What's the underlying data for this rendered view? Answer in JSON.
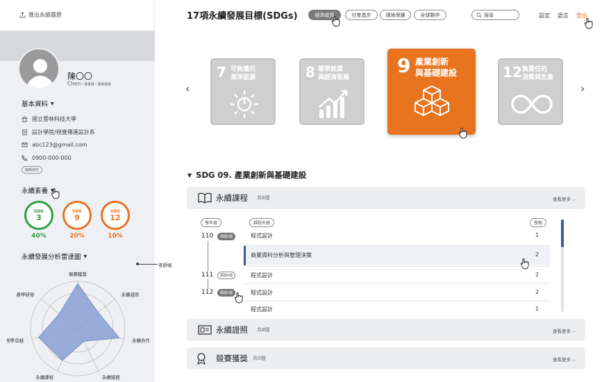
{
  "sidebar": {
    "export_label": "匯出永續履歷",
    "name": "陳〇〇",
    "username": "Chen-aaa-aaaa",
    "basic_title": "基本資料",
    "school": "國立雲林科技大學",
    "department": "設計學院/視覺傳達設計系",
    "email": "abc123@gmail.com",
    "phone": "0900-000-000",
    "edit_label": "編輯資料",
    "literacy_title": "永續素養",
    "rings": [
      {
        "label": "SDG",
        "num": "3",
        "pct": "40%",
        "color": "#2f9e44",
        "level": 0.4
      },
      {
        "label": "SDG",
        "num": "9",
        "pct": "20%",
        "color": "#e8741f",
        "level": 0.2
      },
      {
        "label": "SDG",
        "num": "12",
        "pct": "10%",
        "color": "#e8741f",
        "level": 0.1
      }
    ],
    "radar_title": "永續發展分析雷達圖",
    "teacher_note": "老師端"
  },
  "chart_data": {
    "type": "radar",
    "axes": [
      "競賽獲獎",
      "永續證照",
      "永續合作",
      "永續服務",
      "永續課程",
      "教學卓越",
      "產學研發"
    ],
    "values": [
      0.95,
      0.55,
      0.9,
      0.3,
      0.75,
      0.85,
      0.5
    ],
    "range": [
      0,
      1
    ],
    "grid": true
  },
  "header": {
    "title": "17項永續發展目標(SDGs)",
    "pills": [
      "經濟成長",
      "社會進步",
      "環境保護",
      "全球夥伴"
    ],
    "active_pill": 0,
    "search_placeholder": "搜尋",
    "links": [
      "設定",
      "語言",
      "登出"
    ],
    "logout_color": "#e8741f"
  },
  "carousel": {
    "cards": [
      {
        "num": "7",
        "title1": "可負擔的",
        "title2": "潔淨能源",
        "icon": "sun-power-icon"
      },
      {
        "num": "8",
        "title1": "尊榮就業",
        "title2": "與經濟發展",
        "icon": "growth-chart-icon"
      },
      {
        "num": "9",
        "title1": "產業創新",
        "title2": "與基礎建設",
        "icon": "cubes-icon"
      },
      {
        "num": "12",
        "title1": "負責任的",
        "title2": "消費與生產",
        "icon": "infinity-icon"
      }
    ],
    "prev": "‹",
    "next": "›"
  },
  "section": {
    "heading": "SDG 09. 產業創新與基礎建設",
    "courses": {
      "label": "永續課程",
      "count": "共8個",
      "more": "查看更多",
      "col_year": "學年度",
      "col_name": "課程名稱",
      "col_period": "學期",
      "years": [
        {
          "year": "110",
          "tag": "展開2個"
        },
        {
          "year": "111",
          "tag": "展開4個"
        },
        {
          "year": "112",
          "tag": "展開2個"
        }
      ],
      "rows": [
        {
          "name": "程式設計",
          "period": "1"
        },
        {
          "name": "商業資料分析與管理決策",
          "period": "2"
        },
        {
          "name": "程式設計",
          "period": "2"
        },
        {
          "name": "程式設計",
          "period": "2"
        },
        {
          "name": "程式設計",
          "period": "1"
        }
      ]
    },
    "certs": {
      "label": "永續證照",
      "count": "共8個",
      "more": "查看更多"
    },
    "awards": {
      "label": "競賽獲獎",
      "count": "共0個",
      "more": "查看更多"
    }
  }
}
